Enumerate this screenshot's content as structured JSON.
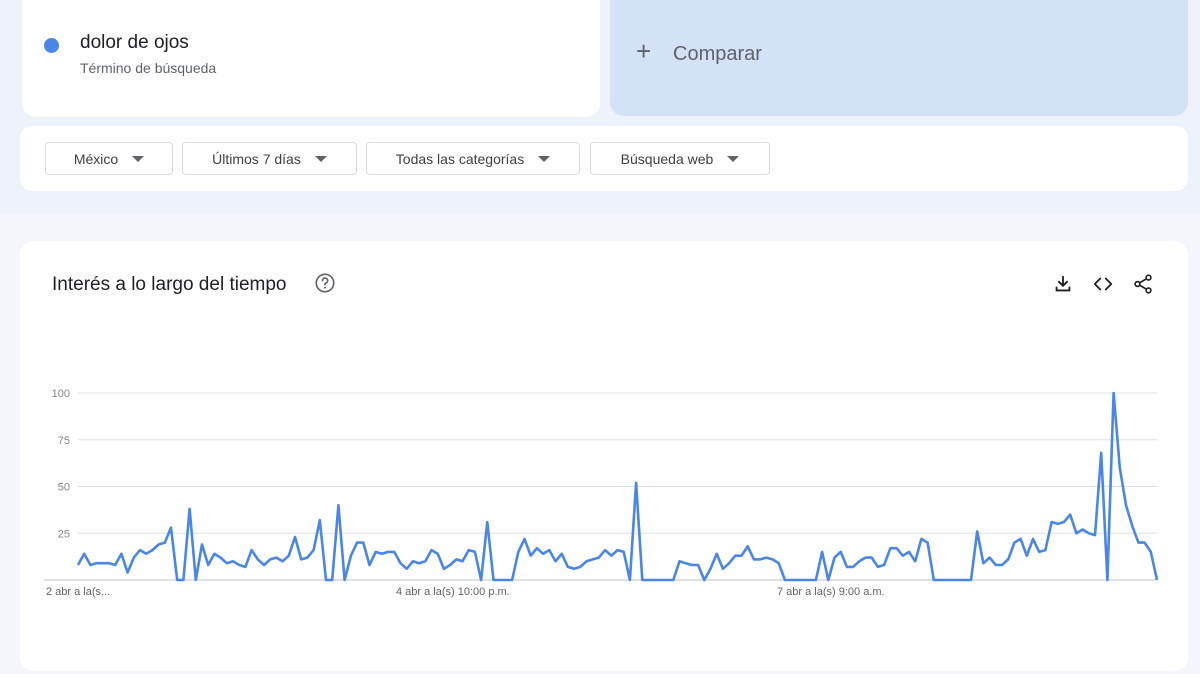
{
  "term": {
    "name": "dolor de ojos",
    "subtitle": "Término de búsqueda",
    "color": "#4a86e8"
  },
  "compare": {
    "icon": "plus-icon",
    "label": "Comparar"
  },
  "filters": [
    {
      "label": "México"
    },
    {
      "label": "Últimos 7 días"
    },
    {
      "label": "Todas las categorías"
    },
    {
      "label": "Búsqueda web"
    }
  ],
  "panel": {
    "title": "Interés a lo largo del tiempo",
    "icons": [
      "help-icon",
      "download-icon",
      "embed-code-icon",
      "share-icon"
    ]
  },
  "chart_data": {
    "type": "line",
    "title": "",
    "ylim": [
      0,
      100
    ],
    "yticks": [
      "25",
      "50",
      "75",
      "100"
    ],
    "xtick_labels": [
      "2 abr a la(s...",
      "4 abr a la(s) 10:00 p.m.",
      "7 abr a la(s) 9:00 a.m."
    ],
    "grid": true,
    "series": [
      {
        "color": "#4a86e8",
        "values": [
          8,
          14,
          8,
          9,
          9,
          9,
          8,
          14,
          4,
          12,
          16,
          14,
          16,
          19,
          20,
          28,
          0,
          0,
          38,
          0,
          19,
          8,
          14,
          12,
          9,
          10,
          8,
          7,
          16,
          11,
          8,
          11,
          12,
          10,
          13,
          23,
          11,
          12,
          16,
          32,
          0,
          0,
          40,
          0,
          13,
          20,
          20,
          8,
          15,
          14,
          15,
          15,
          9,
          6,
          10,
          9,
          10,
          16,
          14,
          6,
          8,
          11,
          10,
          16,
          15,
          0,
          31,
          0,
          0,
          0,
          0,
          15,
          22,
          13,
          17,
          14,
          16,
          10,
          14,
          7,
          6,
          7,
          10,
          11,
          12,
          16,
          13,
          16,
          15,
          0,
          52,
          0,
          0,
          0,
          0,
          0,
          0,
          10,
          9,
          8,
          8,
          0,
          6,
          14,
          6,
          9,
          13,
          13,
          18,
          11,
          11,
          12,
          11,
          9,
          0,
          0,
          0,
          0,
          0,
          0,
          15,
          0,
          12,
          15,
          7,
          7,
          10,
          12,
          12,
          7,
          8,
          17,
          17,
          13,
          15,
          10,
          22,
          20,
          0,
          0,
          0,
          0,
          0,
          0,
          0,
          26,
          9,
          12,
          8,
          8,
          11,
          20,
          22,
          13,
          22,
          15,
          16,
          31,
          30,
          31,
          35,
          25,
          27,
          25,
          24,
          68,
          0,
          100,
          60,
          40,
          29,
          20,
          20,
          15,
          0
        ]
      }
    ]
  }
}
